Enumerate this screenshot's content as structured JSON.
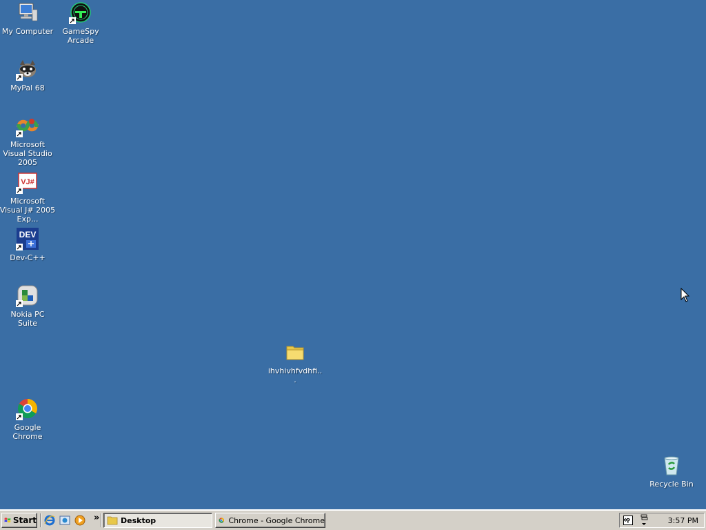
{
  "desktop": {
    "background_color": "#3a6ea5",
    "icons": {
      "my_computer": "My Computer",
      "gamespy": "GameSpy Arcade",
      "mypal": "MyPal 68",
      "vs2005": "Microsoft Visual Studio 2005",
      "vjsharp": "Microsoft Visual J# 2005 Exp...",
      "devcpp": "Dev-C++",
      "nokia": "Nokia PC Suite",
      "folder": "ihvhivhfvdhfi...",
      "chrome": "Google Chrome",
      "recycle": "Recycle Bin"
    },
    "icon_glyphs": {
      "devcpp_text": "DEV",
      "vjsharp_text": "VJ#"
    }
  },
  "taskbar": {
    "start_label": "Start",
    "quick_launch_overflow": "»",
    "buttons": {
      "desktop": "Desktop",
      "chrome": "Chrome - Google Chrome"
    },
    "tray_overflow": "«",
    "clock": "3:57 PM"
  }
}
